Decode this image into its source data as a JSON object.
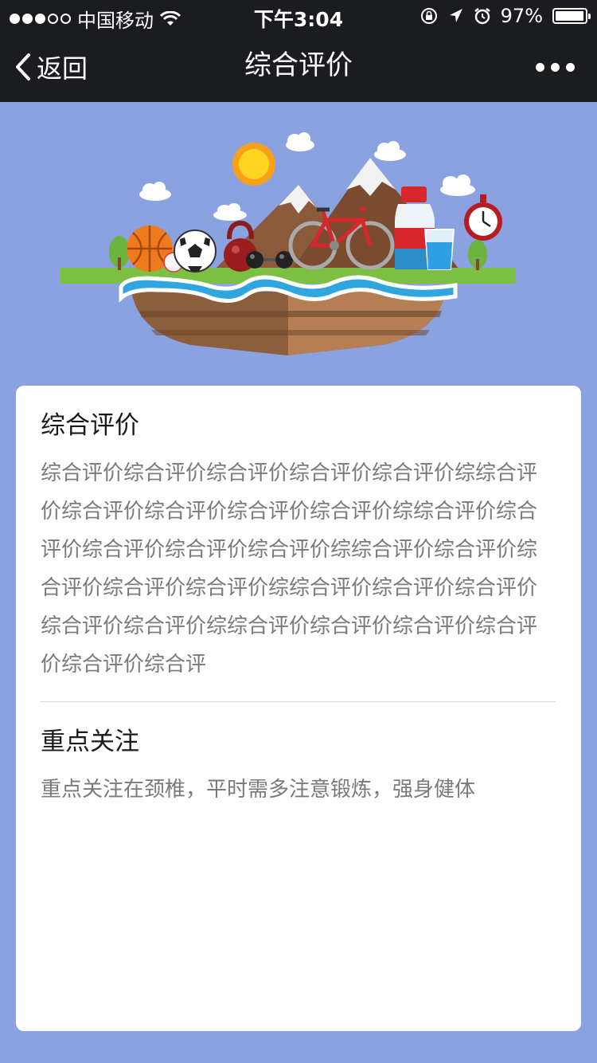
{
  "status_bar": {
    "carrier": "中国移动",
    "time": "下午3:04",
    "battery_percent": "97%",
    "battery_level": 0.97,
    "signal_bars_filled": 3,
    "signal_bars_total": 5
  },
  "nav": {
    "back_label": "返回",
    "title": "综合评价"
  },
  "sections": [
    {
      "title": "综合评价",
      "text": "综合评价综合评价综合评价综合评价综合评价综综合评价综合评价综合评价综合评价综合评价综综合评价综合评价综合评价综合评价综合评价综综合评价综合评价综合评价综合评价综合评价综综合评价综合评价综合评价综合评价综合评价综综合评价综合评价综合评价综合评价综合评价综合评"
    },
    {
      "title": "重点关注",
      "text": "重点关注在颈椎，平时需多注意锻炼，强身健体"
    }
  ],
  "colors": {
    "background": "#8aa2df",
    "bar": "#1b1c20",
    "card": "#ffffff",
    "title_text": "#1a1a1a",
    "body_text": "#7a7a7a"
  },
  "icons": {
    "back": "chevron-left-icon",
    "more": "more-dots-icon",
    "wifi": "wifi-icon",
    "lock": "orientation-lock-icon",
    "location": "location-arrow-icon",
    "alarm": "alarm-icon",
    "battery": "battery-icon"
  }
}
